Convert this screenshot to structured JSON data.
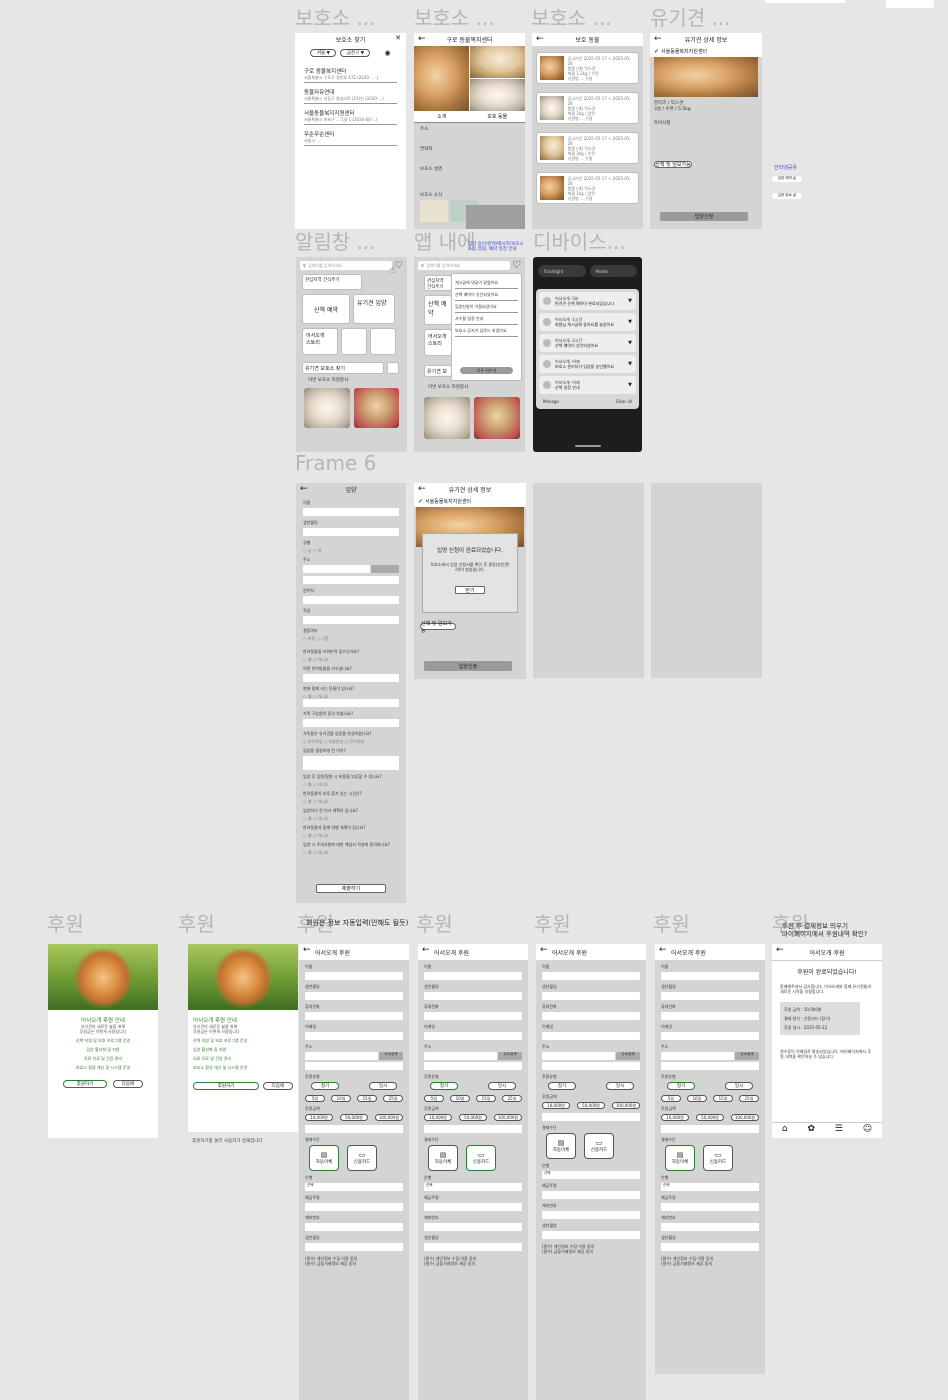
{
  "frame_labels": {
    "f1": "보호소 ...",
    "f2": "보호소 ...",
    "f3": "보호소 ...",
    "f4": "유기견 ...",
    "r2a": "알림창 ...",
    "r2b": "앱 내에",
    "r2c": "디바이스...",
    "r3": "Frame 6",
    "r4": [
      "후원",
      "후원",
      "후원",
      "후원",
      "후원",
      "후원",
      "후원"
    ]
  },
  "annotations": {
    "r4_header": "회원은 정보 자동입력(안해도 될듯)",
    "r4_last": "후원 후 결제정보 띄우기\n마이페이지에서 후원내역 확인?",
    "r2_app": "입양 승인/반려/메시지/보호소 소식 알림, 예약 일정 안내",
    "side_1": "인터넷공유",
    "side_2": "입양 예약 글",
    "side_3": "입양 완료 글"
  },
  "shelter_search": {
    "title": "보호소 찾기",
    "filter_city": "서울 ▼",
    "filter_district": "금천구 ▼",
    "items": [
      {
        "name": "구로 동물복지센터",
        "sub": "서울특별시 구로구 경인로 472 (2030 - ...)"
      },
      {
        "name": "동물자유연대",
        "sub": "서울특별시 성동구 왕십리로 (21)인 (2030-...)"
      },
      {
        "name": "서울동물복지지원센터",
        "sub": "서울특별시 마포구 ... 1길 1 (2030-00-...)"
      },
      {
        "name": "무순무순센터",
        "sub": "서울시 ..."
      }
    ]
  },
  "shelter_detail": {
    "title": "구로 동물복지센터",
    "tab1": "소개",
    "tab2": "보호 동물",
    "addr_label": "주소",
    "phone_label": "연락처",
    "desc_label": "보호소 설명",
    "news_label": "보호소 소식"
  },
  "protected": {
    "title": "보호 동물",
    "rows": [
      {
        "l1": "공고기간 2025-05-17 ~ 2025-05-26",
        "l2": "품종 (개) 믹스견",
        "l3": "체중 1.2kg / 수컷",
        "l4": "기관명 ... 구청"
      },
      {
        "l1": "공고기간 2025-05-17 ~ 2025-05-26",
        "l2": "품종 (개) 믹스견",
        "l3": "체중 2kg / 암컷",
        "l4": "기관명 ... 구청"
      },
      {
        "l1": "공고기간 2025-05-17 ~ 2025-05-26",
        "l2": "품종 (개) 믹스견",
        "l3": "체중 3kg / 수컷",
        "l4": "기관명 ... 구청"
      },
      {
        "l1": "공고기간 2025-05-17 ~ 2025-05-26",
        "l2": "품종 (개) 믹스견",
        "l3": "체중 1kg / 암컷",
        "l4": "기관명 ... 구청"
      }
    ]
  },
  "dog_detail": {
    "title": "유기견 상세 정보",
    "shelter": "서울동물복지지원센터",
    "info": "말티즈 / 믹스견",
    "age": "3살 / 수컷 / 5.5kg",
    "spec_label": "특이사항",
    "tag": "산책 및 임보가능",
    "adopt": "입양신청"
  },
  "notif": {
    "search": "검색어를 입력하세요",
    "recent": "관심지역 간식주기",
    "walk": "산책 예약",
    "adopt": "유기견 입양",
    "story": "어서오개\n스토리",
    "find": "유기견 보호소 찾기",
    "shelter_intro": "이번 보호소 자원봉사",
    "menu": [
      "게시글에 댓글이 달렸어요",
      "산책 예약이 승인되었어요",
      "입양신청이 거절되었어요",
      "사수할 일정 안내",
      "보호소 공지가 업로드 되었어요"
    ],
    "all": "모두 지우기"
  },
  "device": {
    "top1": "Flashlight",
    "top2": "Modes",
    "items": [
      {
        "t": "어서오개 ·5분",
        "d": "반려견 산책 예약이 완료되었습니다"
      },
      {
        "t": "어서오개 ·1시간",
        "d": "회원님 게시글에 좋아요를 눌렀어요"
      },
      {
        "t": "어서오개 ·2시간",
        "d": "산책 예약이 승인되었어요"
      },
      {
        "t": "어서오개 ·어제",
        "d": "보호소 관리자가 입양을 승인했어요"
      },
      {
        "t": "어서오개 ·어제",
        "d": "산책 일정 안내"
      }
    ],
    "manage": "Manage",
    "clear": "Clear all"
  },
  "adopt_form": {
    "title": "입양",
    "fields": [
      "이름",
      "생년월일",
      "성별",
      "주소",
      "연락처",
      "직업",
      "결혼여부"
    ],
    "qs": [
      "반려동물을 키워본적 있으신가요?",
      "어떤 반려동물을 키우셨나요?",
      "현재 함께 사는 동물이 있나요?",
      "가족 구성원이 동의 하셨나요?",
      "가족들은 유기견을 입양을 찬성하셨나요?",
      "입양을 결정하게 된 이유?",
      "입양 후 입원/질병 시 비용을 부담할 수 있나요?",
      "반려동물이 하루 혼자 있는 시간은?",
      "입양하기 전 이사 계획이 있나요?",
      "반려동물과 함께 여행 계획이 있나요?",
      "입양 시 주의사항에 대한 책임서 작성에 동의하나요?"
    ],
    "submit": "제출하기",
    "yes": "예",
    "no": "아니오"
  },
  "modal": {
    "title": "유기견 상세 정보",
    "shelter": "서울동물복지지원센터",
    "msg": "입양 신청이 완료되었습니다.",
    "sub": "보호소에서 입양 신청서를 확인 후 결정(승인/반려)이 발송됩니다.",
    "ok": "닫기",
    "tag": "산책 및 임보가능",
    "adopt": "입양신청"
  },
  "donate_intro": {
    "title": "어서오개 후원 안내",
    "title2": "어서오개 후원 안내",
    "lines": [
      "유기견의 새로운 삶을 위해",
      "후원금은 이렇게 사용됩니다",
      "산책 지원 및 보호 프로그램 운영",
      "입양 활성화 및 지원",
      "의료 치료 및 건강 관리",
      "보호소 환경 개선 및 시스템 운영"
    ],
    "btn_next": "다음에",
    "btn_go": "후원하기",
    "note": "후원하기를 눌러 사용자가 정해집니다"
  },
  "donate_form": {
    "title": "어서오개 후원",
    "name": "이름",
    "birth": "생년월일",
    "phone": "휴대전화",
    "email": "이메일",
    "addr": "주소",
    "addr_btn": "주소검색",
    "type_label": "후원유형",
    "regular": "정기",
    "once": "일시",
    "days": [
      "5일",
      "10일",
      "15일",
      "25일"
    ],
    "amount_label": "후원금액",
    "amounts": [
      "10,000원",
      "50,000원",
      "100,000원"
    ],
    "amounts2": [
      "10,000원",
      "50,000원",
      "100,000원"
    ],
    "method_label": "결제수단",
    "auto": "자동이체",
    "card": "신용카드",
    "bank_label": "은행",
    "bank": "선택",
    "holder": "예금주명",
    "acct": "계좌번호",
    "birth2": "생년월일",
    "agree1": "(필수) 개인정보 수집·이용 동의",
    "agree2": "(필수) 금융거래정보 제공 동의",
    "btn_prev": "이전으로",
    "btn_ok": "후원하기",
    "card_label": "카드번호",
    "valid": "유효기간",
    "cvc": "CVC"
  },
  "donate_done": {
    "title": "어서오개 후원",
    "heading": "후원이 완료되었습니다!",
    "thanks": "함께해주셔서 감사합니다. 어서오개와 함께 유기견들의 새로운 시작을 지원합니다.",
    "amount": "후원 금액 : 50,000원",
    "method": "결제 방식 : 신용카드 (정기)",
    "date": "후원 일시 : 2025-05-22",
    "footer": "영수증이 이메일로 발송되었습니다. 마이페이지에서 후원 내역을 확인하실 수 있습니다."
  }
}
